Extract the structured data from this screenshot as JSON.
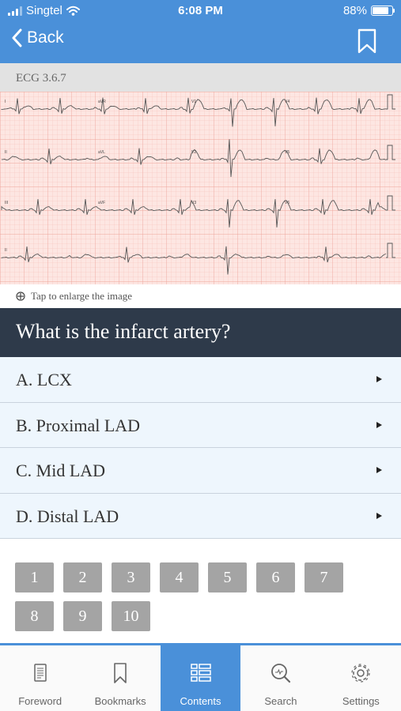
{
  "status_bar": {
    "carrier": "Singtel",
    "time": "6:08 PM",
    "battery_percent": "88%",
    "battery_level": 0.88
  },
  "nav": {
    "back_label": "Back"
  },
  "ecg": {
    "title": "ECG 3.6.7",
    "leads": [
      "I",
      "aVR",
      "V1",
      "V4",
      "II",
      "aVL",
      "V2",
      "V5",
      "III",
      "aVF",
      "V3",
      "V6",
      "II"
    ],
    "enlarge_text": "Tap to enlarge the image"
  },
  "question": {
    "text": "What is the infarct artery?"
  },
  "answers": [
    {
      "label": "A. LCX"
    },
    {
      "label": "B. Proximal LAD"
    },
    {
      "label": "C. Mid LAD"
    },
    {
      "label": "D. Distal LAD"
    }
  ],
  "pagination": {
    "pages": [
      "1",
      "2",
      "3",
      "4",
      "5",
      "6",
      "7",
      "8",
      "9",
      "10"
    ],
    "current": "7"
  },
  "tabs": [
    {
      "label": "Foreword",
      "icon": "document-icon"
    },
    {
      "label": "Bookmarks",
      "icon": "bookmark-icon"
    },
    {
      "label": "Contents",
      "icon": "list-icon",
      "active": true
    },
    {
      "label": "Search",
      "icon": "search-icon"
    },
    {
      "label": "Settings",
      "icon": "gear-icon"
    }
  ],
  "colors": {
    "accent": "#4a90d9",
    "dark": "#2e3a4a",
    "answer_bg": "#eef6fd",
    "page_inactive": "#a4a4a4"
  }
}
